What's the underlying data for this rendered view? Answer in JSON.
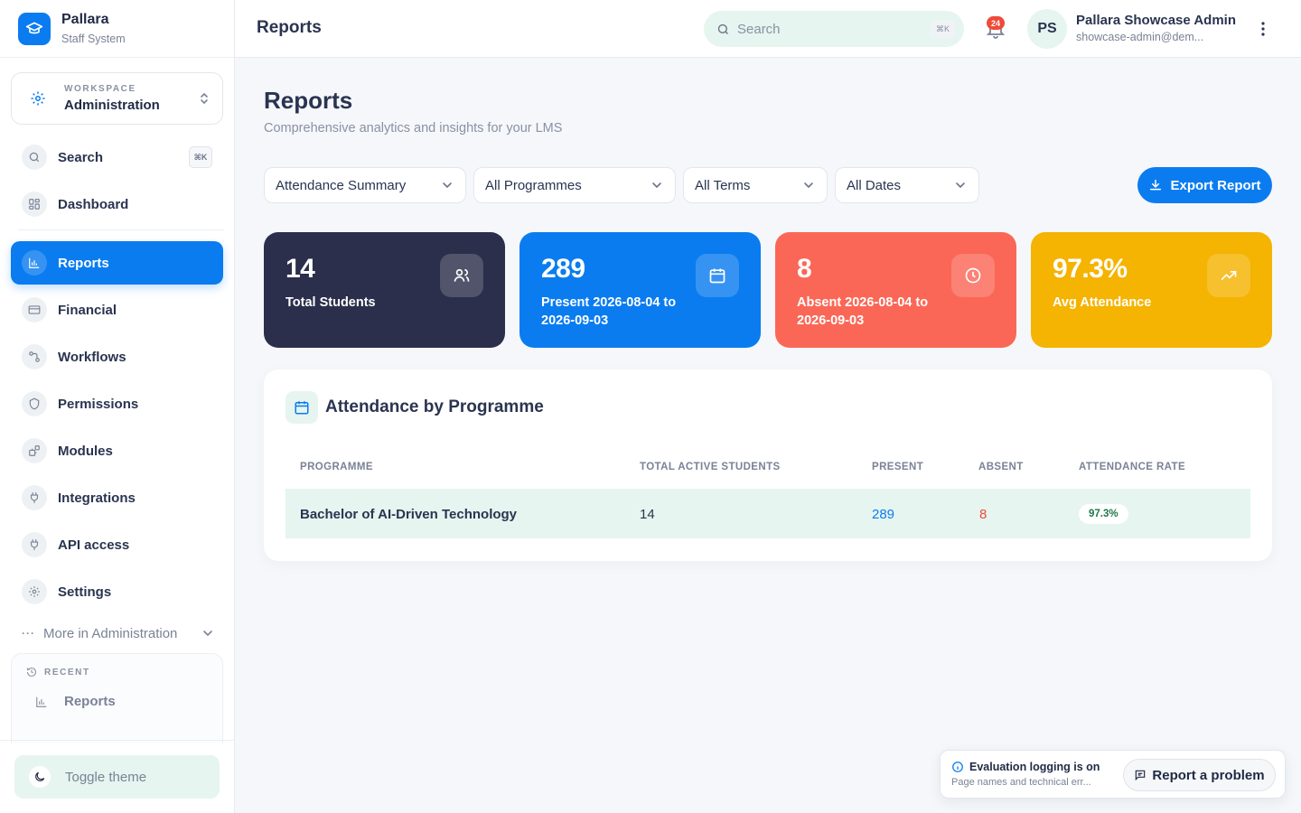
{
  "brand": {
    "name": "Pallara",
    "subtitle": "Staff System"
  },
  "workspace": {
    "label": "WORKSPACE",
    "value": "Administration"
  },
  "sidebar": {
    "items": [
      {
        "label": "Search",
        "shortcut": "⌘K",
        "icon": "search-icon"
      },
      {
        "label": "Dashboard",
        "icon": "dashboard-icon"
      },
      {
        "label": "Reports",
        "icon": "bar-chart-icon",
        "active": true
      },
      {
        "label": "Financial",
        "icon": "credit-card-icon"
      },
      {
        "label": "Workflows",
        "icon": "workflow-icon"
      },
      {
        "label": "Permissions",
        "icon": "shield-icon"
      },
      {
        "label": "Modules",
        "icon": "modules-icon"
      },
      {
        "label": "Integrations",
        "icon": "plug-icon"
      },
      {
        "label": "API access",
        "icon": "plug-icon"
      },
      {
        "label": "Settings",
        "icon": "gear-icon"
      }
    ],
    "more": "More in Administration",
    "recent": {
      "label": "RECENT",
      "items": [
        {
          "label": "Reports",
          "icon": "bar-chart-icon"
        }
      ]
    },
    "toggle_theme": "Toggle theme"
  },
  "header": {
    "title": "Reports",
    "search": {
      "placeholder": "Search",
      "shortcut": "⌘K"
    },
    "notifications": "24",
    "user": {
      "initials": "PS",
      "name": "Pallara Showcase Admin",
      "email": "showcase-admin@dem..."
    }
  },
  "main": {
    "title": "Reports",
    "subtitle": "Comprehensive analytics and insights for your LMS",
    "filters": [
      {
        "value": "Attendance Summary"
      },
      {
        "value": "All Programmes"
      },
      {
        "value": "All Terms"
      },
      {
        "value": "All Dates"
      }
    ],
    "export_label": "Export Report",
    "stats": [
      {
        "value": "14",
        "label": "Total Students",
        "color": "#2b2f4b",
        "icon": "users-icon"
      },
      {
        "value": "289",
        "label": "Present 2026-08-04 to 2026-09-03",
        "color": "#0a7cf0",
        "icon": "calendar-icon"
      },
      {
        "value": "8",
        "label": "Absent 2026-08-04 to 2026-09-03",
        "color": "#fb6756",
        "icon": "clock-icon"
      },
      {
        "value": "97.3%",
        "label": "Avg Attendance",
        "color": "#f5b302",
        "icon": "trending-up-icon"
      }
    ],
    "table": {
      "title": "Attendance by Programme",
      "columns": [
        "PROGRAMME",
        "TOTAL ACTIVE STUDENTS",
        "PRESENT",
        "ABSENT",
        "ATTENDANCE RATE"
      ],
      "rows": [
        {
          "programme": "Bachelor of AI-Driven Technology",
          "total": "14",
          "present": "289",
          "absent": "8",
          "rate": "97.3%"
        }
      ]
    }
  },
  "toast": {
    "title": "Evaluation logging is on",
    "text": "Page names and technical err...",
    "button": "Report a problem"
  },
  "colors": {
    "accent": "#0a7cf0",
    "mint": "#e6f5ef",
    "present": "#0a7cf0",
    "absent": "#ee4b3a",
    "rate": "#1e7a4a"
  }
}
